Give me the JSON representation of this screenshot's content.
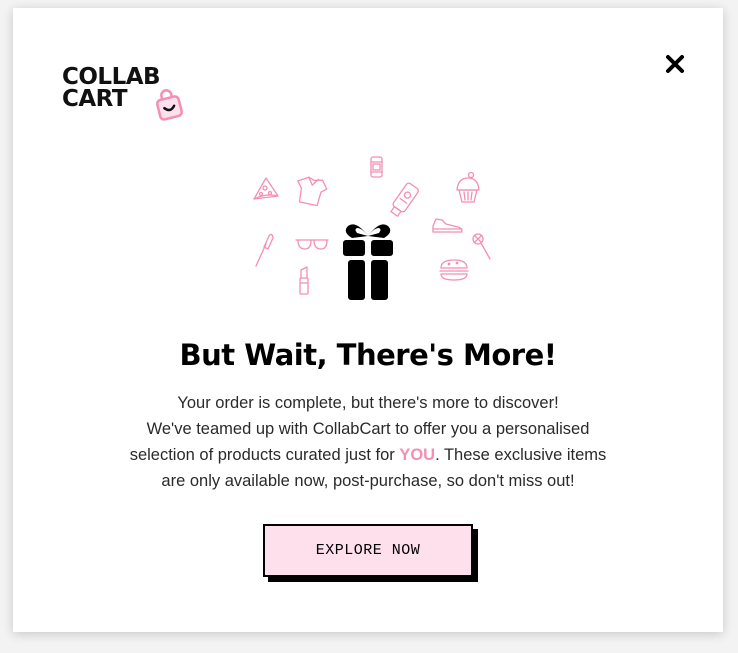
{
  "brand": {
    "logo_line1": "COLLAB",
    "logo_line2": "CART",
    "accent_color": "#f48fb1",
    "button_bg": "#fde0ec"
  },
  "modal": {
    "close_icon": "close-x-icon",
    "headline": "But Wait, There's More!",
    "body_line1": "Your order is complete, but there's more to discover!",
    "body_line2": "We've teamed up with CollabCart to offer you a personalised",
    "body_line3_pre": "selection of products curated just for ",
    "body_line3_highlight": "YOU",
    "body_line3_post": ". These exclusive items",
    "body_line4": "are only available now, post-purchase, so don't miss out!",
    "cta_label": "EXPLORE NOW"
  },
  "illustration": {
    "center_icon": "gift-icon",
    "scattered_icons": [
      "pizza-icon",
      "shirt-icon",
      "soda-can-icon",
      "lotion-tube-icon",
      "cupcake-icon",
      "makeup-brush-icon",
      "sunglasses-icon",
      "sneaker-icon",
      "lipstick-icon",
      "burger-icon",
      "wand-icon"
    ]
  }
}
